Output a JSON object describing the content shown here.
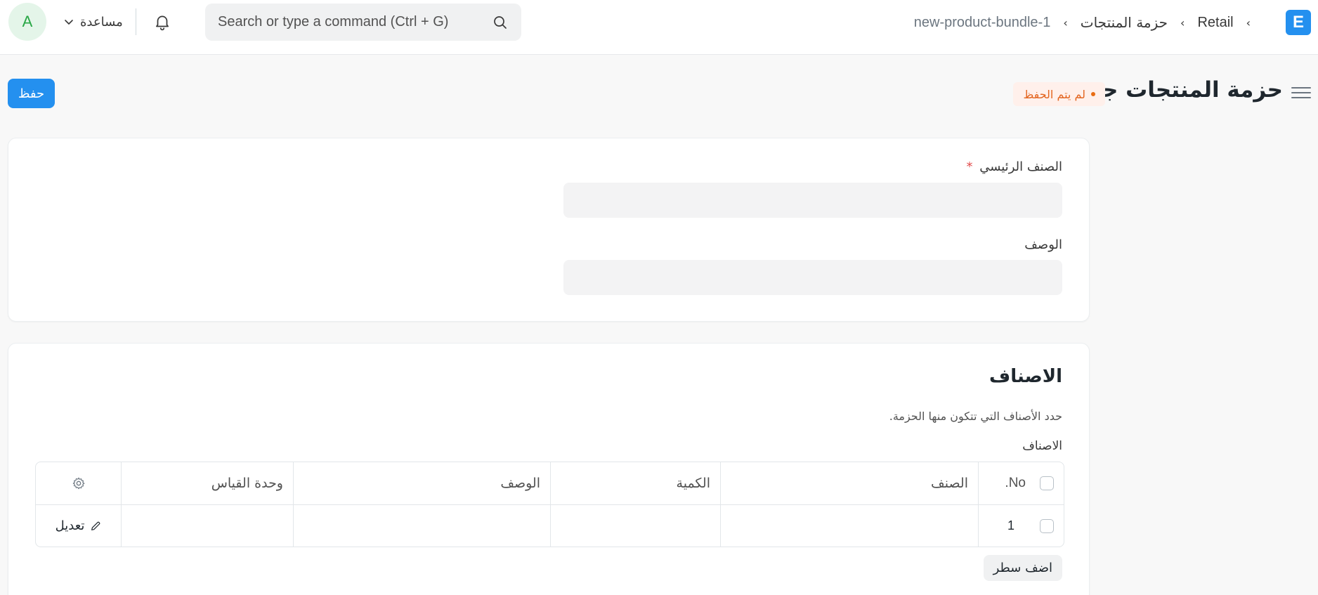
{
  "navbar": {
    "avatar_initial": "A",
    "help_label": "مساعدة",
    "search_placeholder": "Search or type a command (Ctrl + G)",
    "breadcrumb": [
      "Retail",
      "حزمة المنتجات",
      "new-product-bundle-1"
    ],
    "logo_letter": "E"
  },
  "page": {
    "title": "حزمة المنتجات جديد",
    "status": "لم يتم الحفظ",
    "save_label": "حفظ"
  },
  "form": {
    "parent_item_label": "الصنف الرئيسي",
    "required_mark": "*",
    "description_label": "الوصف"
  },
  "items_section": {
    "title": "الاصناف",
    "description": "حدد الأصناف التي تتكون منها الحزمة.",
    "table_label": "الاصناف",
    "columns": {
      "no": "No.",
      "item": "الصنف",
      "qty": "الكمية",
      "description": "الوصف",
      "uom": "وحدة القياس"
    },
    "rows": [
      {
        "no": "1",
        "item": "",
        "qty": "",
        "description": "",
        "uom": "",
        "action": "تعديل"
      }
    ],
    "add_row_label": "اضف سطر"
  },
  "colors": {
    "primary": "#2490ef",
    "status_text": "#e3641e",
    "status_bg": "#fff0eb",
    "avatar_text": "#28a745",
    "avatar_bg": "#e4f5e9"
  },
  "icons": [
    "chevron-down-icon",
    "bell-icon",
    "search-icon",
    "hamburger-icon",
    "gear-icon",
    "pencil-icon"
  ]
}
